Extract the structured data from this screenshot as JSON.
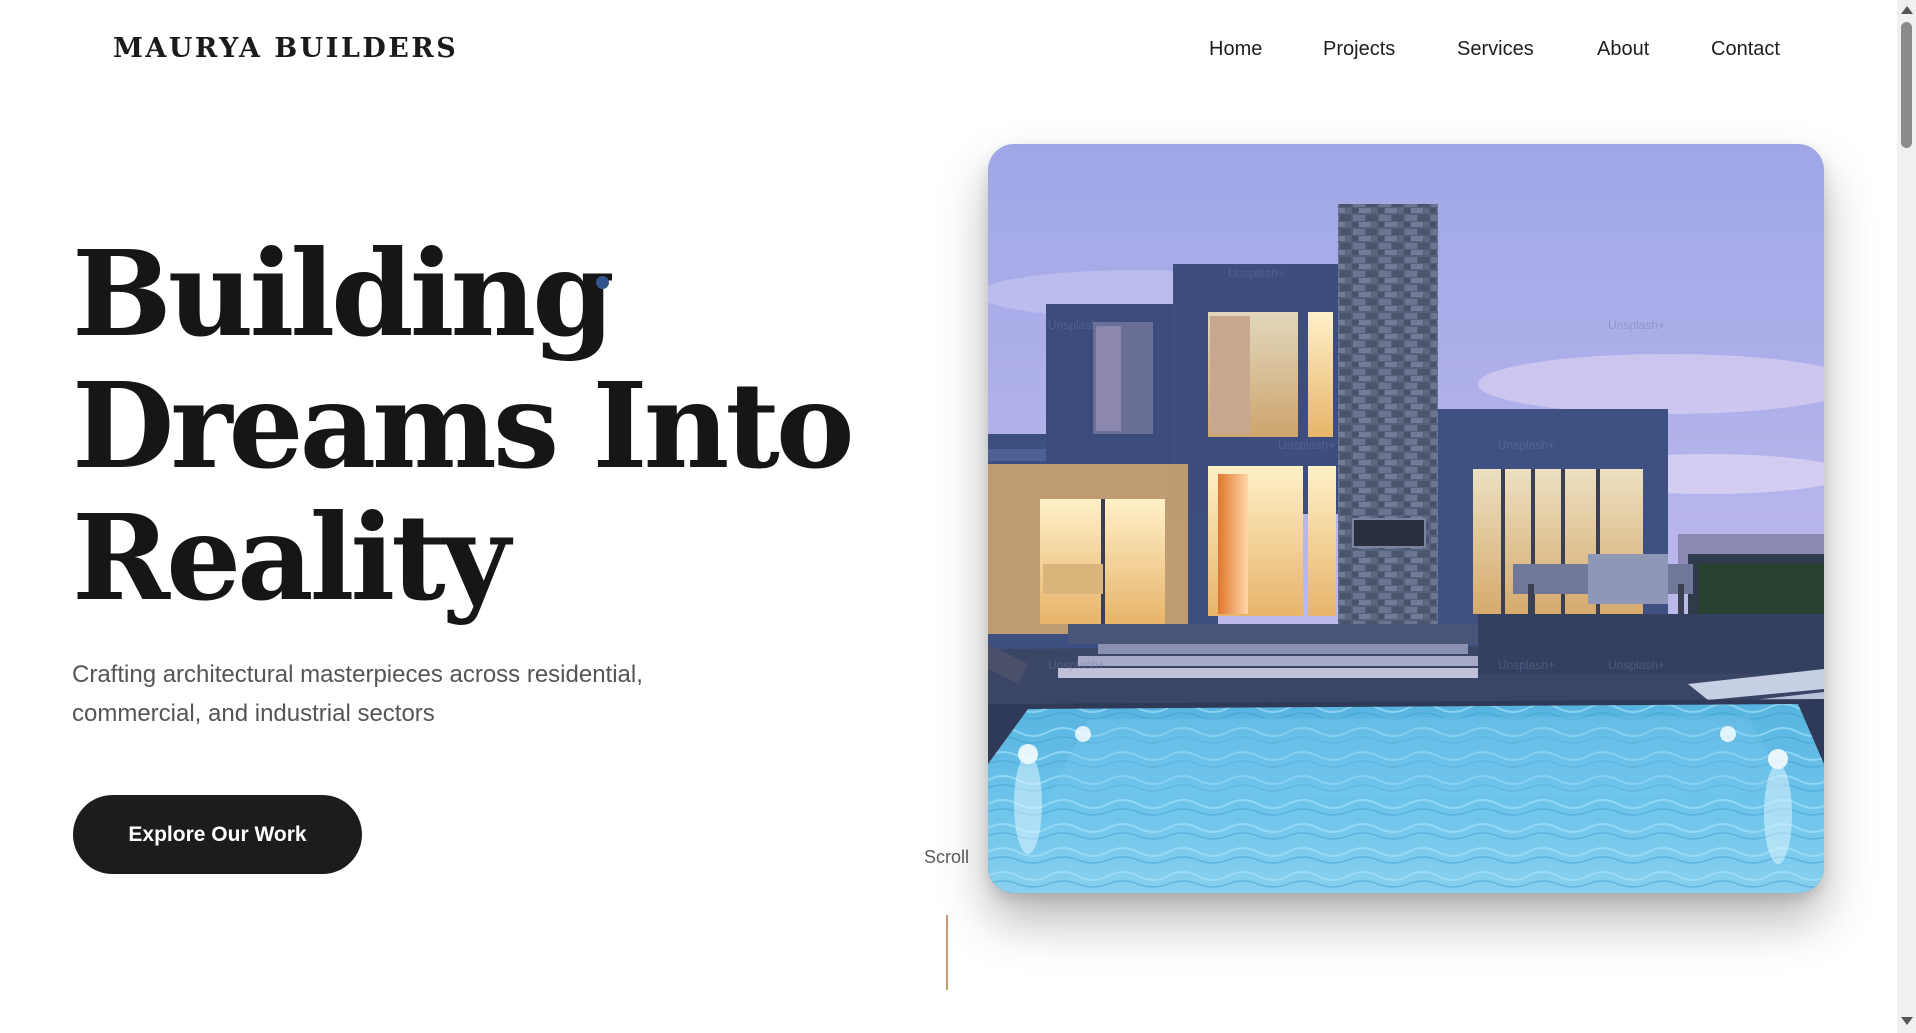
{
  "header": {
    "logo": "MAURYA BUILDERS",
    "nav": [
      "Home",
      "Projects",
      "Services",
      "About",
      "Contact"
    ]
  },
  "hero": {
    "title_lines": [
      "Building",
      "Dreams Into",
      "Reality"
    ],
    "subtitle_line1": "Crafting architectural masterpieces across residential,",
    "subtitle_line2": "commercial, and industrial sectors",
    "cta": "Explore Our Work",
    "scroll_label": "Scroll",
    "watermark": "Unsplash+"
  },
  "colors": {
    "accent_dot": "#33558f",
    "scroll_line": "#c99a6c",
    "cta_bg": "#1c1c1c"
  }
}
